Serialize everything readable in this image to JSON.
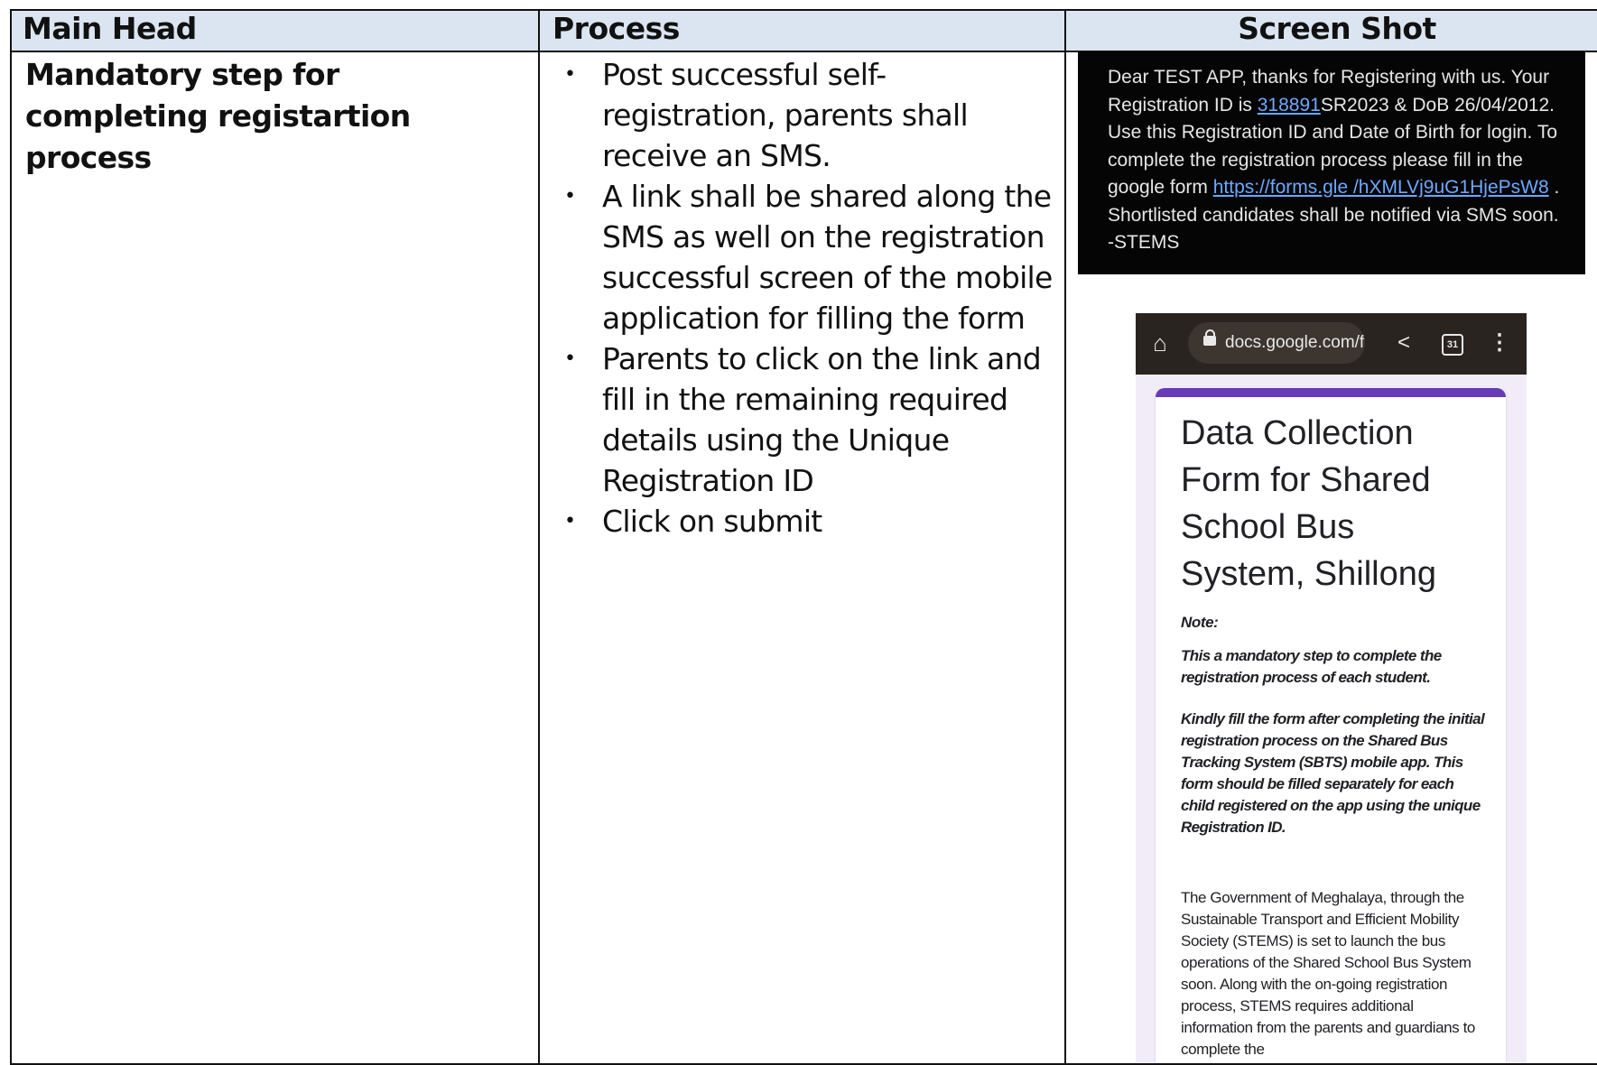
{
  "header": {
    "main_head": "Main Head",
    "process": "Process",
    "screen_shot": "Screen Shot"
  },
  "row": {
    "main_head": "Mandatory step for completing registartion process",
    "steps": [
      "Post successful self-registration, parents shall receive an SMS.",
      "A link shall be shared along the SMS as well on the registration successful screen of the mobile application for filling the form",
      "Parents to click on the link and fill in the remaining required details using the Unique Registration ID",
      "Click on submit"
    ]
  },
  "sms": {
    "text_1": "Dear TEST APP, thanks for Registering with us. Your Registration ID is ",
    "reg_link": "318891",
    "text_2": "SR2023 & DoB 26/04/2012. Use this Registration ID and Date of Birth for login. To complete the registration process please fill in the google form ",
    "form_link": "https://forms.gle /hXMLVj9uG1HjePsW8",
    "text_3": " . Shortlisted candidates shall be notified via SMS soon. -STEMS"
  },
  "browser": {
    "url": "docs.google.com/f",
    "calendar_badge": "31",
    "icons": [
      "home-icon",
      "lock-icon",
      "share-icon",
      "calendar-icon",
      "more-vert-icon"
    ]
  },
  "form": {
    "title": "Data Collection Form for Shared School Bus System, Shillong",
    "note_label": "Note:",
    "note_1": "This a mandatory step to complete the registration process of each student.",
    "note_2": "Kindly fill the form after completing the initial registration process on the Shared Bus Tracking System (SBTS) mobile app. This form should be filled separately for each child registered on the app using the unique Registration ID.",
    "body": "The Government of Meghalaya, through the Sustainable Transport and Efficient Mobility Society (STEMS) is set to launch the bus operations of the Shared School Bus System soon. Along with the on-going registration process, STEMS requires additional information from the parents and guardians to complete the"
  },
  "colors": {
    "header_bg": "#dbe5f1",
    "form_accent": "#673ab7",
    "link": "#6ea8ff"
  }
}
